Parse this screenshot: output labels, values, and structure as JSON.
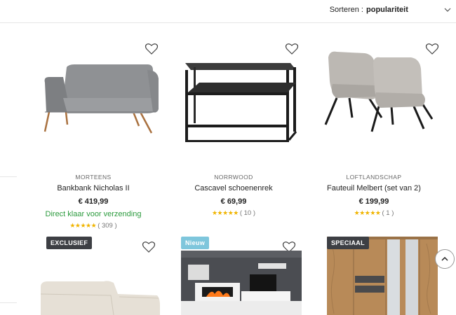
{
  "sort": {
    "label": "Sorteren :",
    "value": "populariteit"
  },
  "products": [
    {
      "brand": "MORTEENS",
      "name": "Bankbank Nicholas II",
      "price": "€ 419,99",
      "shipping": "Direct klaar voor verzending",
      "stars": "★★★★★",
      "reviews": "( 309 )",
      "rating": 4.5
    },
    {
      "brand": "NORRWOOD",
      "name": "Cascavel schoenenrek",
      "price": "€ 69,99",
      "stars": "★★★★★",
      "reviews": "( 10 )",
      "rating": 4.5
    },
    {
      "brand": "LOFTLANDSCHAP",
      "name": "Fauteuil Melbert (set van 2)",
      "price": "€ 199,99",
      "stars": "★★★★★",
      "reviews": "( 1 )",
      "rating": 5
    }
  ],
  "row2": [
    {
      "badge": "EXCLUSIEF"
    },
    {
      "badge": "Nieuw"
    },
    {
      "badge": "SPECIAAL"
    }
  ],
  "icons": {
    "heart": "heart-icon",
    "sort": "chevron-down-icon",
    "scroll": "chevron-up-icon"
  },
  "colors": {
    "ship": "#2a9a3c",
    "star": "#f0b400",
    "badge_dark": "#3d3f44",
    "badge_blue": "#7ec6dc"
  }
}
